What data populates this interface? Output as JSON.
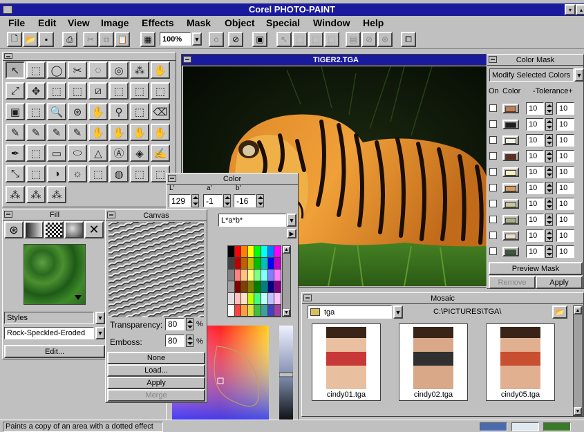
{
  "app": {
    "title": "Corel PHOTO-PAINT"
  },
  "menu": [
    "File",
    "Edit",
    "View",
    "Image",
    "Effects",
    "Mask",
    "Object",
    "Special",
    "Window",
    "Help"
  ],
  "toolbar": {
    "zoom": "100%"
  },
  "image_window": {
    "title": "TIGER2.TGA"
  },
  "color_mask": {
    "title": "Color Mask",
    "mode": "Modify Selected Colors",
    "col_on": "On",
    "col_color": "Color",
    "col_tolerance": "-Tolerance+",
    "rows": [
      {
        "color": "#c87a4a",
        "tol": "10",
        "tol2": "10"
      },
      {
        "color": "#1e1e1e",
        "tol": "10",
        "tol2": "10"
      },
      {
        "color": "#f4f0e4",
        "tol": "10",
        "tol2": "10"
      },
      {
        "color": "#6a2a1a",
        "tol": "10",
        "tol2": "10"
      },
      {
        "color": "#f8f0b8",
        "tol": "10",
        "tol2": "10"
      },
      {
        "color": "#d89a5a",
        "tol": "10",
        "tol2": "10"
      },
      {
        "color": "#c8c89a",
        "tol": "10",
        "tol2": "10"
      },
      {
        "color": "#a8b088",
        "tol": "10",
        "tol2": "10"
      },
      {
        "color": "#e8e0c8",
        "tol": "10",
        "tol2": "10"
      },
      {
        "color": "#3a5a38",
        "tol": "10",
        "tol2": "10"
      }
    ],
    "preview_label": "Preview Mask",
    "remove_label": "Remove",
    "apply_label": "Apply"
  },
  "color_panel": {
    "title": "Color",
    "l_label": "L'",
    "a_label": "a'",
    "b_label": "b'",
    "l_value": "129",
    "a_value": "-1",
    "b_value": "-16",
    "model": "L*a*b*",
    "palette": [
      "#000000",
      "#ff0000",
      "#ff8000",
      "#ffff00",
      "#00ff00",
      "#00ffff",
      "#0080ff",
      "#ff00ff",
      "#404040",
      "#c00000",
      "#c06000",
      "#c0c000",
      "#00c000",
      "#00c0c0",
      "#0000ff",
      "#c000c0",
      "#808080",
      "#ff8080",
      "#ffc080",
      "#ffff80",
      "#80ff80",
      "#80ffff",
      "#8080ff",
      "#ff80ff",
      "#a0a0a0",
      "#800000",
      "#804000",
      "#808000",
      "#008000",
      "#008080",
      "#000080",
      "#800080",
      "#e0e0e0",
      "#ffc0c0",
      "#ffe0c0",
      "#c0ff00",
      "#40ff80",
      "#c0ffff",
      "#c0c0ff",
      "#ffc0ff",
      "#ffffff",
      "#ff4040",
      "#ffa040",
      "#e0e040",
      "#40c040",
      "#40a0a0",
      "#4040c0",
      "#a040a0"
    ]
  },
  "fill_panel": {
    "title": "Fill",
    "styles_label": "Styles",
    "style_value": "Rock-Speckled-Eroded",
    "edit_label": "Edit..."
  },
  "canvas_panel": {
    "title": "Canvas",
    "transparency_label": "Transparency:",
    "transparency_value": "80",
    "emboss_label": "Emboss:",
    "emboss_value": "80",
    "pct": "%",
    "none_label": "None",
    "load_label": "Load...",
    "apply_label": "Apply",
    "merge_label": "Merge"
  },
  "mosaic": {
    "title": "Mosaic",
    "folder": "tga",
    "path": "C:\\PICTURES\\TGA\\",
    "items": [
      {
        "name": "cindy01.tga"
      },
      {
        "name": "cindy02.tga"
      },
      {
        "name": "cindy05.tga"
      }
    ]
  },
  "status": {
    "text": "Paints a copy of an area with a dotted effect"
  }
}
